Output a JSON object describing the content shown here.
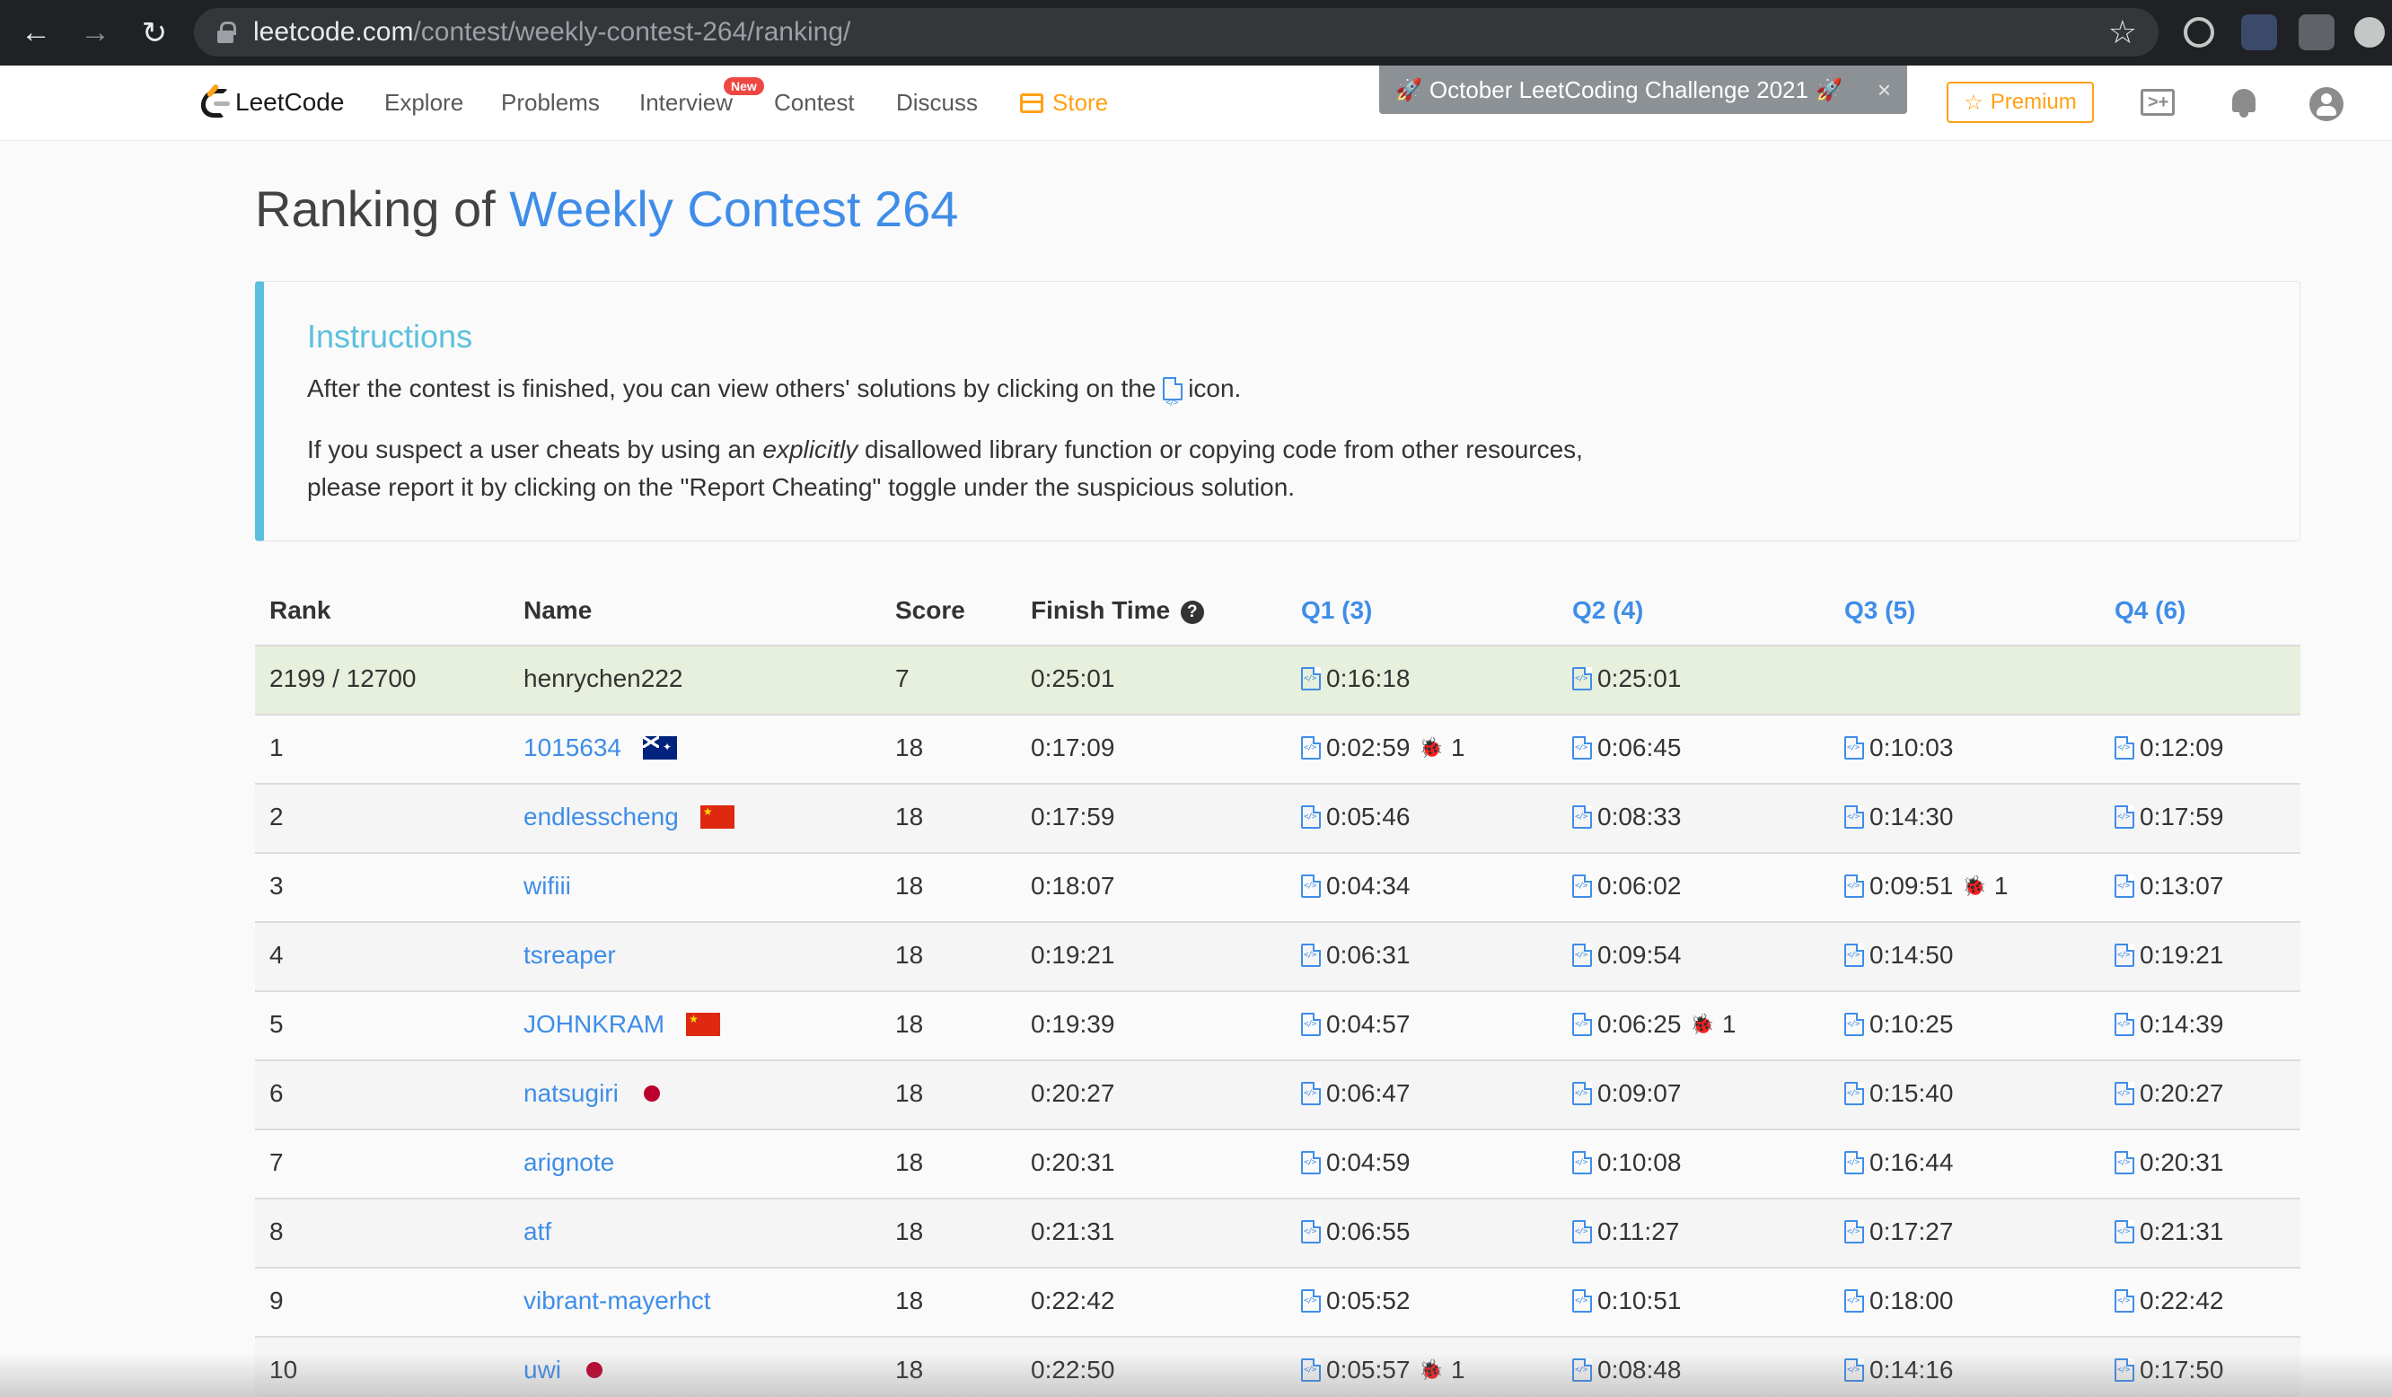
{
  "browser": {
    "url_host": "leetcode.com",
    "url_path": "/contest/weekly-contest-264/ranking/"
  },
  "navbar": {
    "logo_text": "LeetCode",
    "items": [
      "Explore",
      "Problems",
      "Interview",
      "Contest",
      "Discuss",
      "Store"
    ],
    "new_badge": "New",
    "promo_text": "October LeetCoding Challenge 2021",
    "promo_rocket": "🚀",
    "promo_close": "×",
    "premium_label": "Premium",
    "premium_icon": "☆"
  },
  "page": {
    "title_prefix": "Ranking of ",
    "title_contest": "Weekly Contest 264"
  },
  "instructions": {
    "title": "Instructions",
    "p1_before": "After the contest is finished, you can view others' solutions by clicking on the",
    "p1_after": "icon.",
    "p2_line1_before": "If you suspect a user cheats by using an ",
    "p2_line1_em": "explicitly",
    "p2_line1_after": " disallowed library function or copying code from other resources,",
    "p2_line2": "please report it by clicking on the \"Report Cheating\" toggle under the suspicious solution."
  },
  "table": {
    "headers": {
      "rank": "Rank",
      "name": "Name",
      "score": "Score",
      "finish": "Finish Time",
      "help": "?",
      "q1": "Q1 (3)",
      "q2": "Q2 (4)",
      "q3": "Q3 (5)",
      "q4": "Q4 (6)"
    },
    "my_row": {
      "rank": "2199 / 12700",
      "name": "henrychen222",
      "score": "7",
      "finish": "0:25:01",
      "q1": "0:16:18",
      "q2": "0:25:01"
    },
    "rows": [
      {
        "rank": "1",
        "name": "1015634",
        "flag": "au",
        "score": "18",
        "finish": "0:17:09",
        "q1": "0:02:59",
        "q1_bugs": "1",
        "q2": "0:06:45",
        "q3": "0:10:03",
        "q4": "0:12:09"
      },
      {
        "rank": "2",
        "name": "endlesscheng",
        "flag": "cn",
        "score": "18",
        "finish": "0:17:59",
        "q1": "0:05:46",
        "q2": "0:08:33",
        "q3": "0:14:30",
        "q4": "0:17:59"
      },
      {
        "rank": "3",
        "name": "wifiii",
        "flag": "",
        "score": "18",
        "finish": "0:18:07",
        "q1": "0:04:34",
        "q2": "0:06:02",
        "q3": "0:09:51",
        "q3_bugs": "1",
        "q4": "0:13:07"
      },
      {
        "rank": "4",
        "name": "tsreaper",
        "flag": "",
        "score": "18",
        "finish": "0:19:21",
        "q1": "0:06:31",
        "q2": "0:09:54",
        "q3": "0:14:50",
        "q4": "0:19:21"
      },
      {
        "rank": "5",
        "name": "JOHNKRAM",
        "flag": "cn",
        "score": "18",
        "finish": "0:19:39",
        "q1": "0:04:57",
        "q2": "0:06:25",
        "q2_bugs": "1",
        "q3": "0:10:25",
        "q4": "0:14:39"
      },
      {
        "rank": "6",
        "name": "natsugiri",
        "flag": "jp",
        "score": "18",
        "finish": "0:20:27",
        "q1": "0:06:47",
        "q2": "0:09:07",
        "q3": "0:15:40",
        "q4": "0:20:27"
      },
      {
        "rank": "7",
        "name": "arignote",
        "flag": "",
        "score": "18",
        "finish": "0:20:31",
        "q1": "0:04:59",
        "q2": "0:10:08",
        "q3": "0:16:44",
        "q4": "0:20:31"
      },
      {
        "rank": "8",
        "name": "atf",
        "flag": "",
        "score": "18",
        "finish": "0:21:31",
        "q1": "0:06:55",
        "q2": "0:11:27",
        "q3": "0:17:27",
        "q4": "0:21:31"
      },
      {
        "rank": "9",
        "name": "vibrant-mayerhct",
        "flag": "",
        "score": "18",
        "finish": "0:22:42",
        "q1": "0:05:52",
        "q2": "0:10:51",
        "q3": "0:18:00",
        "q4": "0:22:42"
      },
      {
        "rank": "10",
        "name": "uwi",
        "flag": "jp",
        "score": "18",
        "finish": "0:22:50",
        "q1": "0:05:57",
        "q1_bugs": "1",
        "q2": "0:08:48",
        "q3": "0:14:16",
        "q4": "0:17:50"
      }
    ]
  },
  "icons": {
    "back": "back-arrow-icon",
    "forward": "forward-arrow-icon",
    "reload": "reload-icon",
    "bookmark": "star-icon",
    "code": "code-file-icon",
    "bug": "bug-icon",
    "bell": "bell-icon",
    "avatar": "avatar-icon",
    "playground": "playground-icon"
  },
  "colors": {
    "link": "#3f8de8",
    "accent_orange": "#ffa116",
    "instructions_accent": "#5bc0de",
    "my_row_bg": "#e6f0dc",
    "bug_red": "#c7302b"
  }
}
